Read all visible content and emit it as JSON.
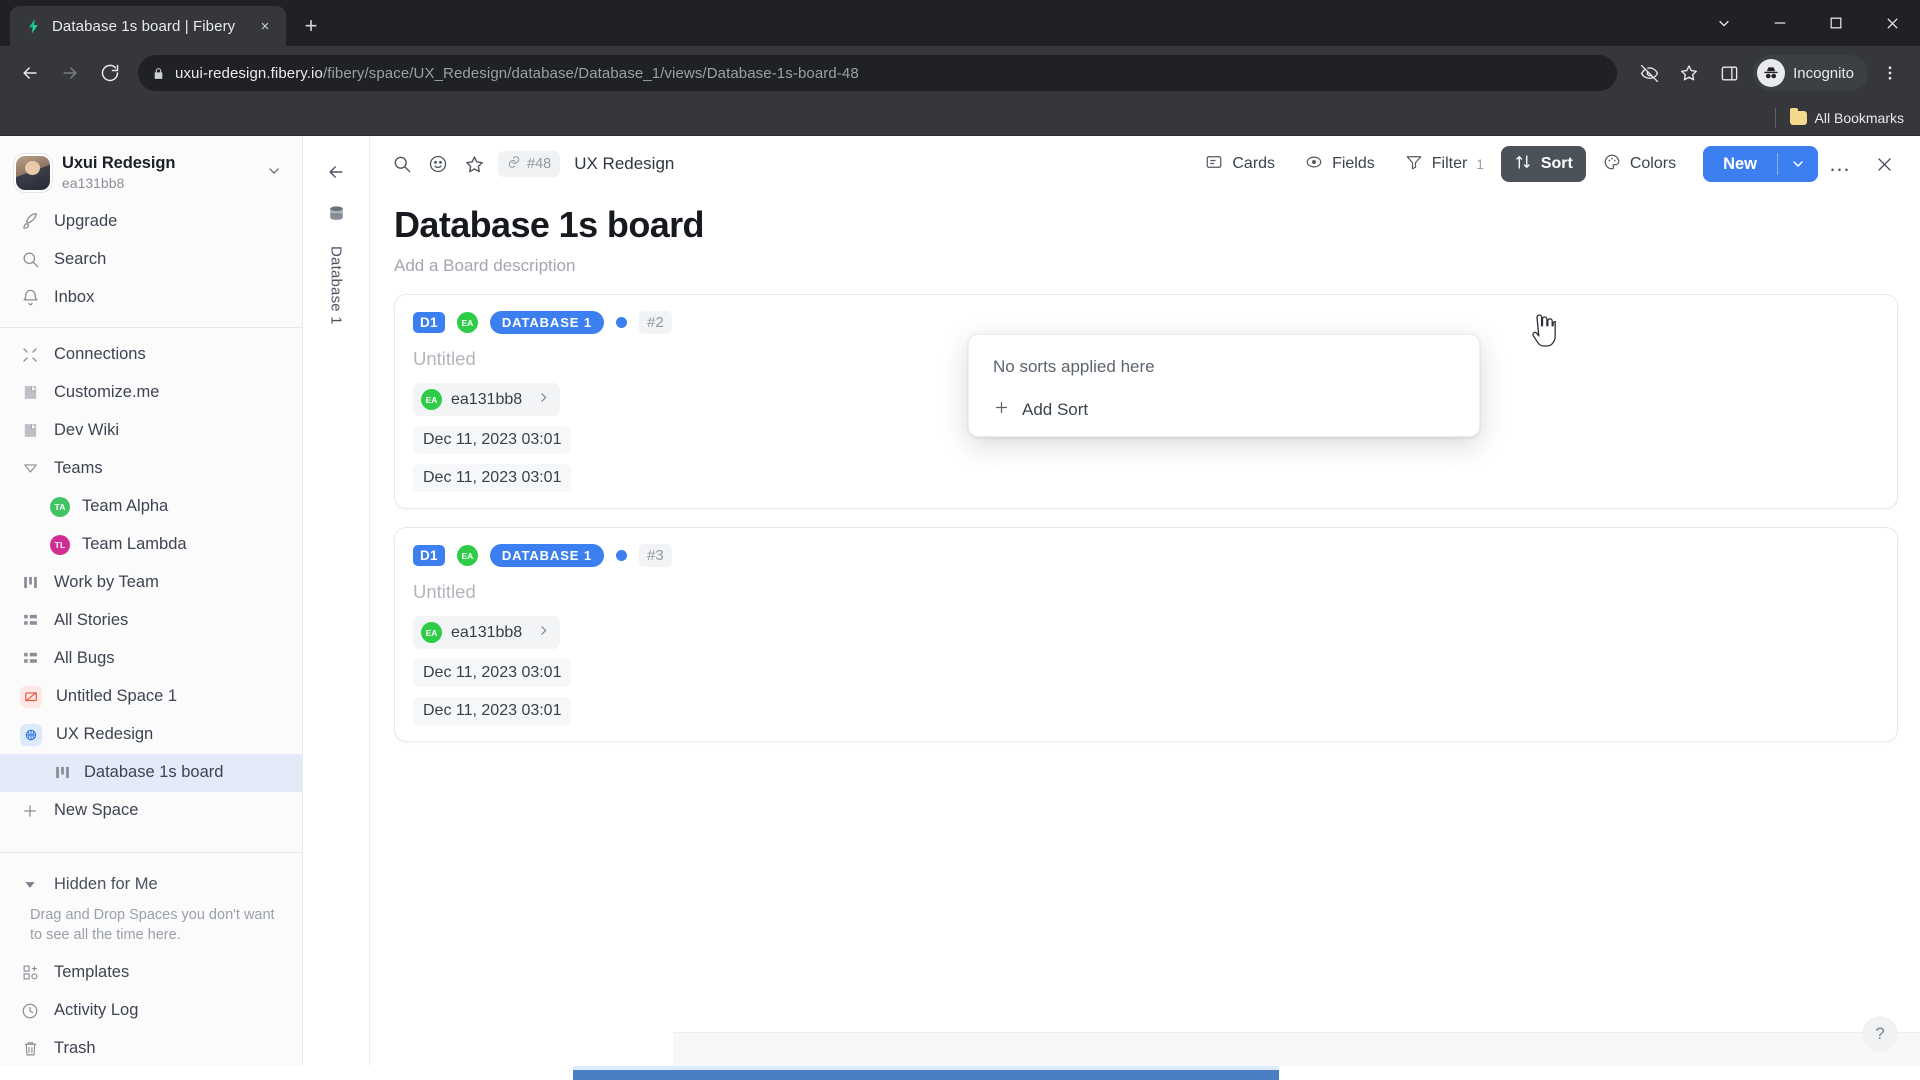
{
  "browser": {
    "tab": {
      "title": "Database 1s board | Fibery",
      "favicon": "fibery-logo-icon",
      "close_label": "×"
    },
    "new_tab_label": "+",
    "window_controls": {
      "minimize": "minimize-icon",
      "maximize": "maximize-icon",
      "close": "close-icon",
      "more": "chevron-down-icon"
    },
    "nav": {
      "back": "back-arrow-icon",
      "forward": "forward-arrow-icon",
      "reload": "reload-icon"
    },
    "omnibox": {
      "lock": "lock-icon",
      "host": "uxui-redesign.fibery.io",
      "path": "/fibery/space/UX_Redesign/database/Database_1/views/Database-1s-board-48"
    },
    "toolbar_icons": {
      "eye_off": "eye-off-icon",
      "bookmark": "star-icon",
      "side_panel": "side-panel-icon",
      "menu": "three-dot-menu-icon"
    },
    "incognito_label": "Incognito",
    "bookmarks": {
      "all_bookmarks_label": "All Bookmarks",
      "folder_icon": "folder-icon"
    }
  },
  "sidebar": {
    "workspace": {
      "name": "Uxui Redesign",
      "user": "ea131bb8",
      "chevron": "chevron-down-icon"
    },
    "top_items": [
      {
        "label": "Upgrade",
        "icon": "rocket-icon"
      },
      {
        "label": "Search",
        "icon": "search-icon"
      },
      {
        "label": "Inbox",
        "icon": "bell-icon"
      }
    ],
    "nav_items": [
      {
        "label": "Connections",
        "icon": "connections-icon",
        "type": "item"
      },
      {
        "label": "Customize.me",
        "icon": "document-icon",
        "type": "item"
      },
      {
        "label": "Dev Wiki",
        "icon": "document-icon",
        "type": "item"
      },
      {
        "label": "Teams",
        "icon": "collapse-triangle-icon",
        "type": "group"
      },
      {
        "label": "Team Alpha",
        "icon": "avatar",
        "initials": "TA",
        "color": "#43c463",
        "type": "child"
      },
      {
        "label": "Team Lambda",
        "icon": "avatar",
        "initials": "TL",
        "color": "#cf2f93",
        "type": "child"
      },
      {
        "label": "Work by Team",
        "icon": "board-icon",
        "type": "item"
      },
      {
        "label": "All Stories",
        "icon": "grid-icon",
        "type": "item"
      },
      {
        "label": "All Bugs",
        "icon": "grid-icon",
        "type": "item"
      },
      {
        "label": "Untitled Space 1",
        "icon": "space-icon-red",
        "type": "space"
      },
      {
        "label": "UX Redesign",
        "icon": "space-icon-blue",
        "type": "space"
      },
      {
        "label": "Database 1s board",
        "icon": "board-icon",
        "type": "child",
        "active": true
      },
      {
        "label": "New Space",
        "icon": "plus-icon",
        "type": "item"
      }
    ],
    "hidden": {
      "label": "Hidden for Me",
      "icon": "expand-triangle-icon",
      "note": "Drag and Drop Spaces you don't want to see all the time here."
    },
    "bottom_items": [
      {
        "label": "Templates",
        "icon": "templates-icon"
      },
      {
        "label": "Activity Log",
        "icon": "clock-icon"
      },
      {
        "label": "Trash",
        "icon": "trash-icon"
      }
    ]
  },
  "rail": {
    "back": "back-arrow-icon",
    "db_icon": "database-icon",
    "label": "Database 1"
  },
  "view_toolbar": {
    "search_icon": "search-icon",
    "emoji_icon": "emoji-icon",
    "star_icon": "star-icon",
    "link_icon": "link-icon",
    "entity_id": "#48",
    "space_name": "UX Redesign",
    "buttons": [
      {
        "label": "Cards",
        "icon": "cards-icon",
        "badge": ""
      },
      {
        "label": "Fields",
        "icon": "fields-icon",
        "badge": ""
      },
      {
        "label": "Filter",
        "icon": "filter-icon",
        "badge": "1"
      },
      {
        "label": "Sort",
        "icon": "sort-icon",
        "badge": "",
        "active": true
      },
      {
        "label": "Colors",
        "icon": "palette-icon",
        "badge": ""
      }
    ],
    "new_button": {
      "label": "New",
      "chevron": "chevron-down-icon"
    },
    "more_label": "…",
    "close_label": "✕"
  },
  "board": {
    "title": "Database 1s board",
    "description_placeholder": "Add a Board description",
    "cards": [
      {
        "pill_short": "D1",
        "avatar_initials": "EA",
        "pill_db": "DATABASE 1",
        "status_dot": "#3b7ff0",
        "number": "#2",
        "title": "Untitled",
        "owner": "ea131bb8",
        "owner_initials": "EA",
        "owner_chevron": "chevron-right-icon",
        "date_created": "Dec 11, 2023 03:01",
        "date_modified": "Dec 11, 2023 03:01"
      },
      {
        "pill_short": "D1",
        "avatar_initials": "EA",
        "pill_db": "DATABASE 1",
        "status_dot": "#3b7ff0",
        "number": "#3",
        "title": "Untitled",
        "owner": "ea131bb8",
        "owner_initials": "EA",
        "owner_chevron": "chevron-right-icon",
        "date_created": "Dec 11, 2023 03:01",
        "date_modified": "Dec 11, 2023 03:01"
      }
    ]
  },
  "sort_popover": {
    "empty_text": "No sorts applied here",
    "add_label": "Add Sort",
    "add_icon": "plus-icon"
  },
  "help": {
    "label": "?"
  },
  "colors": {
    "accent_blue": "#3b7ff0",
    "active_dark": "#4b5259",
    "green_avatar": "#2ecc47",
    "sidebar_active": "#e4eaf7",
    "scrollbar": "#4a7fc1"
  }
}
